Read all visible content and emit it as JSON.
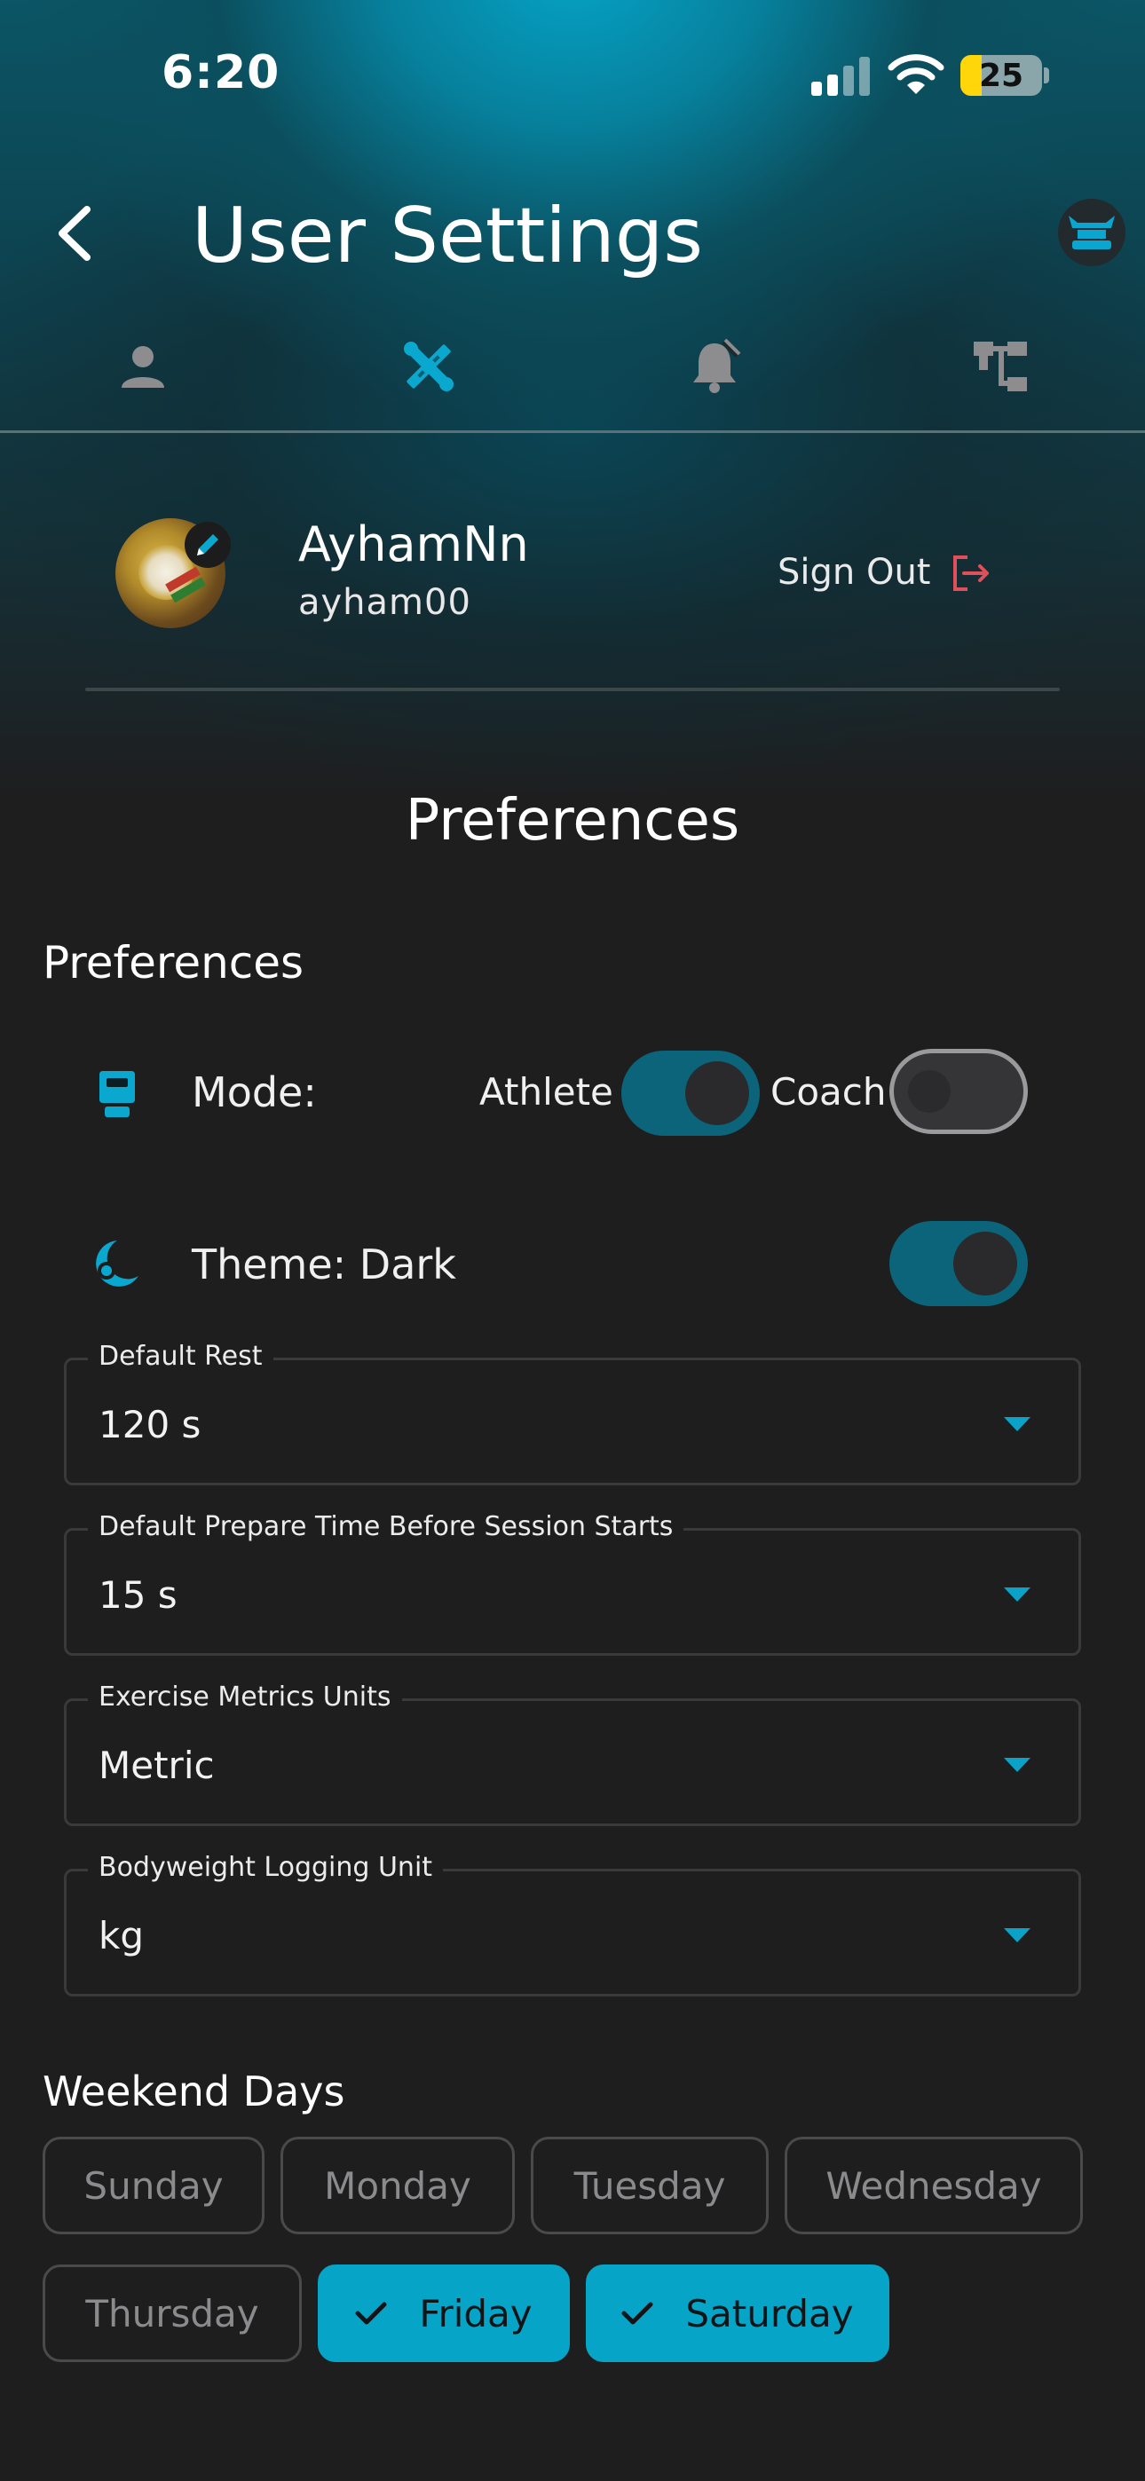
{
  "status_bar": {
    "time": "6:20",
    "battery": "25"
  },
  "header": {
    "title": "User Settings"
  },
  "tabs": [
    {
      "icon": "person-icon"
    },
    {
      "icon": "tools-icon"
    },
    {
      "icon": "notification-bell-icon"
    },
    {
      "icon": "hierarchy-icon"
    }
  ],
  "profile": {
    "name": "AyhamNn",
    "username": "ayham00",
    "sign_out_label": "Sign Out"
  },
  "preferences": {
    "page_title": "Preferences",
    "section_title": "Preferences",
    "mode": {
      "label": "Mode:",
      "athlete_label": "Athlete",
      "athlete_on": true,
      "coach_label": "Coach",
      "coach_on": false
    },
    "theme": {
      "label": "Theme: Dark",
      "on": true
    },
    "fields": [
      {
        "label": "Default Rest",
        "value": "120 s"
      },
      {
        "label": "Default Prepare Time Before Session Starts",
        "value": "15 s"
      },
      {
        "label": "Exercise Metrics Units",
        "value": "Metric"
      },
      {
        "label": "Bodyweight Logging Unit",
        "value": "kg"
      }
    ]
  },
  "weekend": {
    "title": "Weekend Days",
    "days": [
      {
        "label": "Sunday",
        "selected": false
      },
      {
        "label": "Monday",
        "selected": false
      },
      {
        "label": "Tuesday",
        "selected": false
      },
      {
        "label": "Wednesday",
        "selected": false
      },
      {
        "label": "Thursday",
        "selected": false
      },
      {
        "label": "Friday",
        "selected": true
      },
      {
        "label": "Saturday",
        "selected": true
      }
    ]
  },
  "colors": {
    "accent": "#06a5c8",
    "toggle_on": "#0b6479",
    "sign_out_icon": "#e0505a",
    "background": "#1e1e1f"
  }
}
